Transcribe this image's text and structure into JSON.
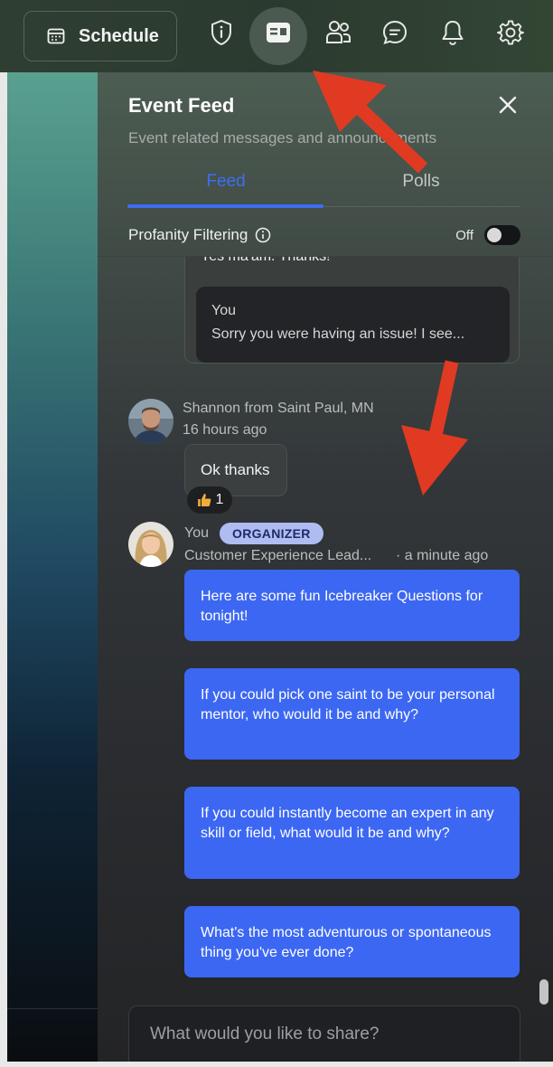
{
  "topbar": {
    "schedule_label": "Schedule",
    "icons": [
      "info-icon",
      "event-feed-icon",
      "people-icon",
      "chat-icon",
      "bell-icon",
      "gear-icon"
    ]
  },
  "panel": {
    "title": "Event Feed",
    "subtitle": "Event related messages and announcements",
    "tabs": [
      {
        "label": "Feed",
        "active": true
      },
      {
        "label": "Polls",
        "active": false
      }
    ],
    "profanity_label": "Profanity Filtering",
    "profanity_state": "Off"
  },
  "feed": {
    "quoted": {
      "text": "Yes ma'am. Thanks!",
      "reply_author": "You",
      "reply_text": "Sorry you were having an issue! I see..."
    },
    "message1": {
      "author": "Shannon from Saint Paul, MN",
      "time": "16 hours ago",
      "text": "Ok thanks",
      "reaction_count": "1"
    },
    "message2": {
      "author": "You",
      "badge": "ORGANIZER",
      "role": "Customer Experience Lead...",
      "time": "· a minute ago",
      "bubbles": [
        "Here are some fun Icebreaker Questions for tonight!",
        "If you could pick one saint to be your personal mentor, who would it be and why?",
        "If you could instantly become an expert in any skill or field, what would it be and why?",
        "What's the most adventurous or spontaneous thing you've ever done?"
      ]
    }
  },
  "composer": {
    "placeholder": "What would you like to share?"
  },
  "colors": {
    "accent": "#3c67f2",
    "badge_bg": "#aebcf2",
    "arrow": "#e03a22"
  }
}
